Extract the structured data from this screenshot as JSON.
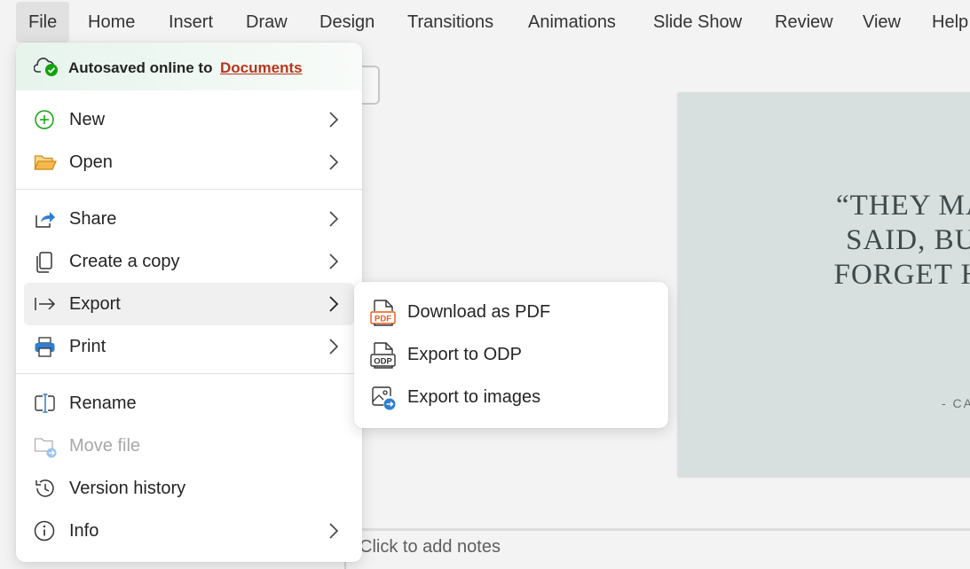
{
  "ribbon": {
    "tabs": [
      "File",
      "Home",
      "Insert",
      "Draw",
      "Design",
      "Transitions",
      "Animations",
      "Slide Show",
      "Review",
      "View",
      "Help"
    ],
    "active_tab": "File"
  },
  "file_menu": {
    "autosave": {
      "label": "Autosaved online to",
      "location": "Documents"
    },
    "items": [
      {
        "label": "New",
        "icon": "plus-circle-icon",
        "submenu": true
      },
      {
        "label": "Open",
        "icon": "folder-icon",
        "submenu": true
      },
      {
        "label": "Share",
        "icon": "share-icon",
        "submenu": true
      },
      {
        "label": "Create a copy",
        "icon": "copy-icon",
        "submenu": true
      },
      {
        "label": "Export",
        "icon": "export-arrow-icon",
        "submenu": true,
        "highlighted": true
      },
      {
        "label": "Print",
        "icon": "printer-icon",
        "submenu": true
      },
      {
        "label": "Rename",
        "icon": "rename-icon",
        "submenu": false
      },
      {
        "label": "Move file",
        "icon": "move-file-icon",
        "submenu": false,
        "disabled": true
      },
      {
        "label": "Version history",
        "icon": "history-icon",
        "submenu": false
      },
      {
        "label": "Info",
        "icon": "info-icon",
        "submenu": true
      }
    ]
  },
  "export_submenu": {
    "items": [
      {
        "label": "Download as PDF",
        "icon": "pdf-file-icon",
        "badge": "PDF"
      },
      {
        "label": "Export to ODP",
        "icon": "odp-file-icon",
        "badge": "ODP"
      },
      {
        "label": "Export to images",
        "icon": "image-export-icon"
      }
    ]
  },
  "slide": {
    "quote_lines": [
      "“THEY MAY F",
      "SAID, BUT T",
      "FORGET HOW"
    ],
    "author": "- CA"
  },
  "notes": {
    "placeholder": "Click to add notes"
  },
  "colors": {
    "accent_link": "#b8361b",
    "autosave_check": "#13a10e",
    "slide_bg": "#d7dfdf",
    "pdf_orange": "#e8591a",
    "folder_orange": "#e8a33d",
    "printer_blue": "#2f7fd1"
  }
}
